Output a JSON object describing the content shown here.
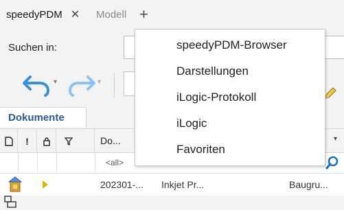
{
  "tabs": {
    "active": {
      "label": "speedyPDM",
      "close": "✕"
    },
    "inactive": {
      "label": "Modell"
    },
    "add": "+"
  },
  "search": {
    "label": "Suchen in:"
  },
  "section": {
    "title": "Dokumente"
  },
  "grid": {
    "header": {
      "col_doc": "D",
      "col_flag": "!",
      "col_lock": "🔒",
      "col_filter": "∇",
      "col_name": "Do..."
    },
    "filter_placeholder": "<all>",
    "row": {
      "number": "202301-...",
      "description": "Inkjet Pr...",
      "group": "Baugru..."
    }
  },
  "menu": {
    "items": [
      "speedyPDM-Browser",
      "Darstellungen",
      "iLogic-Protokoll",
      "iLogic",
      "Favoriten"
    ]
  },
  "colors": {
    "accent": "#2a5b8f",
    "undo": "#3a8fd6",
    "redo": "#8ec3ef",
    "filter_icon": "#1f6fc0",
    "arrow": "#e2b400"
  }
}
